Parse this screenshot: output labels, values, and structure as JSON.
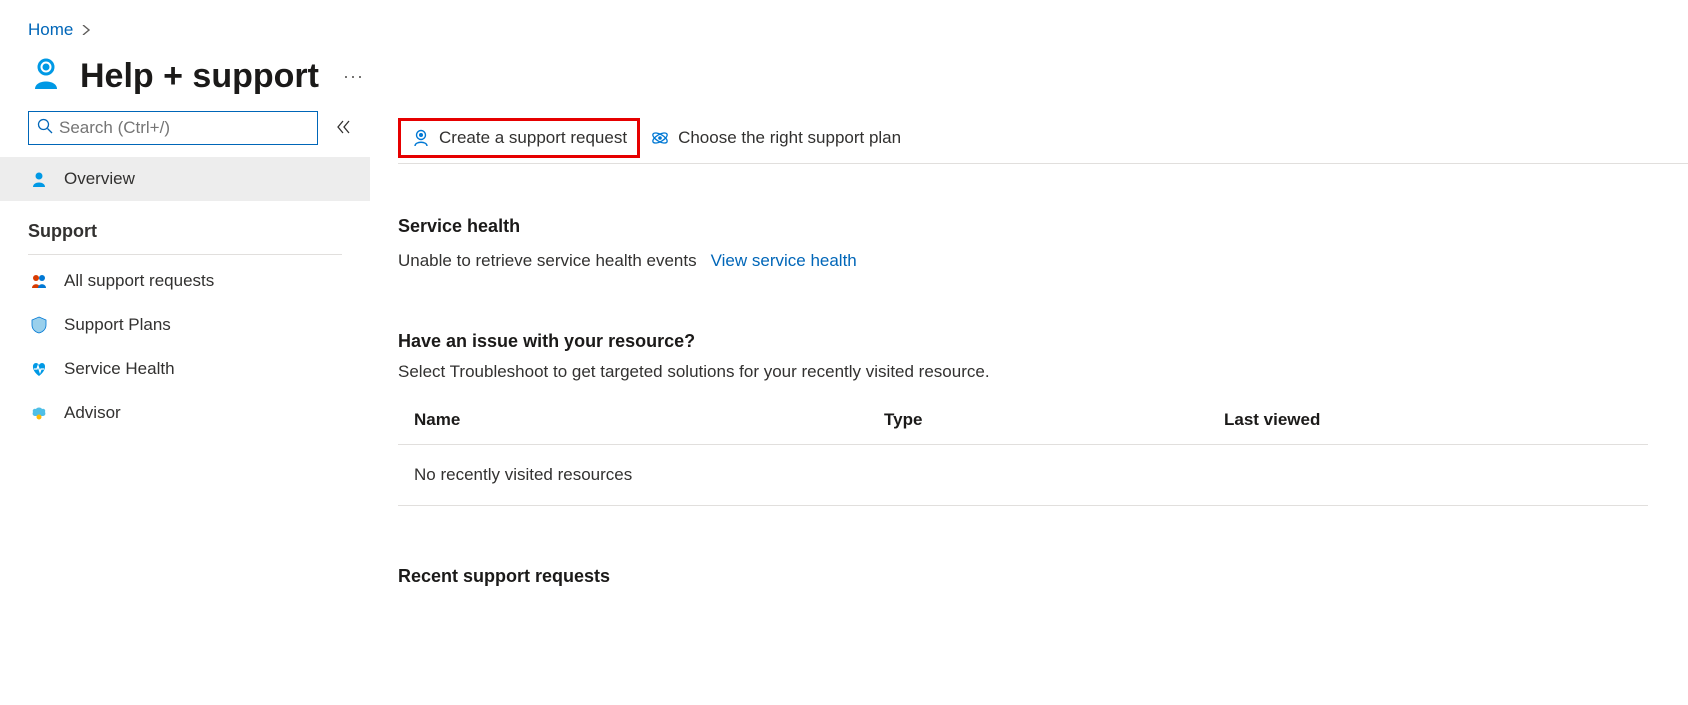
{
  "breadcrumb": {
    "home": "Home"
  },
  "header": {
    "title": "Help + support",
    "more": "···"
  },
  "sidebar": {
    "search_placeholder": "Search (Ctrl+/)",
    "items": {
      "overview": "Overview",
      "section_support": "Support",
      "all_requests": "All support requests",
      "support_plans": "Support Plans",
      "service_health": "Service Health",
      "advisor": "Advisor"
    }
  },
  "toolbar": {
    "create": "Create a support request",
    "choose": "Choose the right support plan"
  },
  "service_health": {
    "heading": "Service health",
    "msg": "Unable to retrieve service health events",
    "link": "View service health"
  },
  "issue": {
    "heading": "Have an issue with your resource?",
    "sub": "Select Troubleshoot to get targeted solutions for your recently visited resource.",
    "cols": {
      "name": "Name",
      "type": "Type",
      "last": "Last viewed"
    },
    "empty": "No recently visited resources"
  },
  "recent": {
    "heading": "Recent support requests"
  }
}
